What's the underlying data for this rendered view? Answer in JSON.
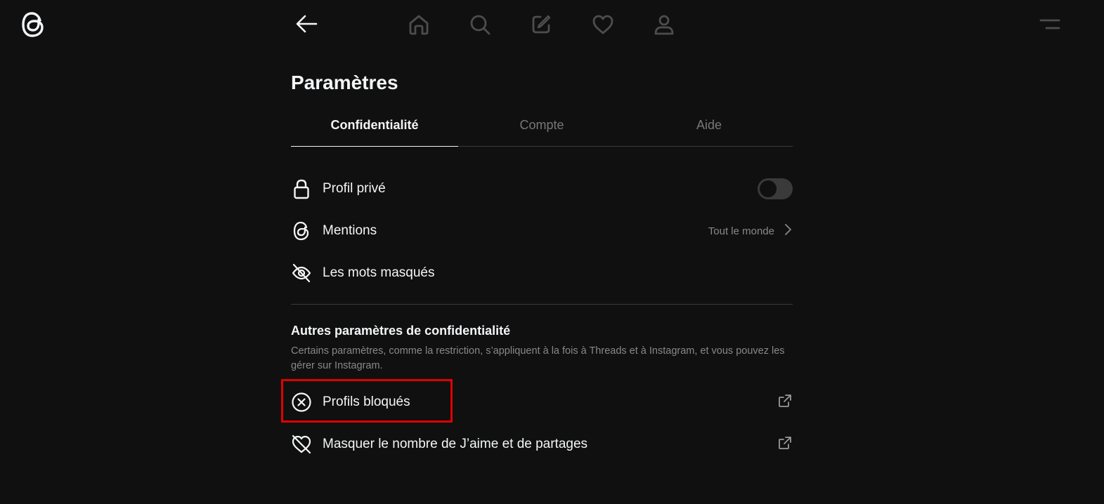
{
  "nav": {
    "icons": [
      "threads-logo-icon",
      "back-arrow-icon",
      "home-icon",
      "search-icon",
      "compose-icon",
      "heart-icon",
      "person-icon",
      "menu-icon"
    ]
  },
  "page": {
    "title": "Paramètres"
  },
  "tabs": [
    {
      "label": "Confidentialité",
      "active": true
    },
    {
      "label": "Compte",
      "active": false
    },
    {
      "label": "Aide",
      "active": false
    }
  ],
  "privacy": {
    "items": [
      {
        "label": "Profil privé",
        "icon": "lock-icon",
        "toggle": false
      },
      {
        "label": "Mentions",
        "icon": "threads-icon",
        "value": "Tout le monde"
      },
      {
        "label": "Les mots masqués",
        "icon": "eye-off-icon"
      }
    ]
  },
  "other": {
    "title": "Autres paramètres de confidentialité",
    "description": "Certains paramètres, comme la restriction, s’appliquent à la fois à Threads et à Instagram, et vous pouvez les gérer sur Instagram.",
    "items": [
      {
        "label": "Profils bloqués",
        "icon": "circle-x-icon",
        "external": true
      },
      {
        "label": "Masquer le nombre de J’aime et de partages",
        "icon": "heart-off-icon",
        "external": true
      }
    ]
  },
  "colors": {
    "background": "#101010",
    "text": "#f3f5f7",
    "muted": "#777777",
    "highlight": "#e00000"
  }
}
